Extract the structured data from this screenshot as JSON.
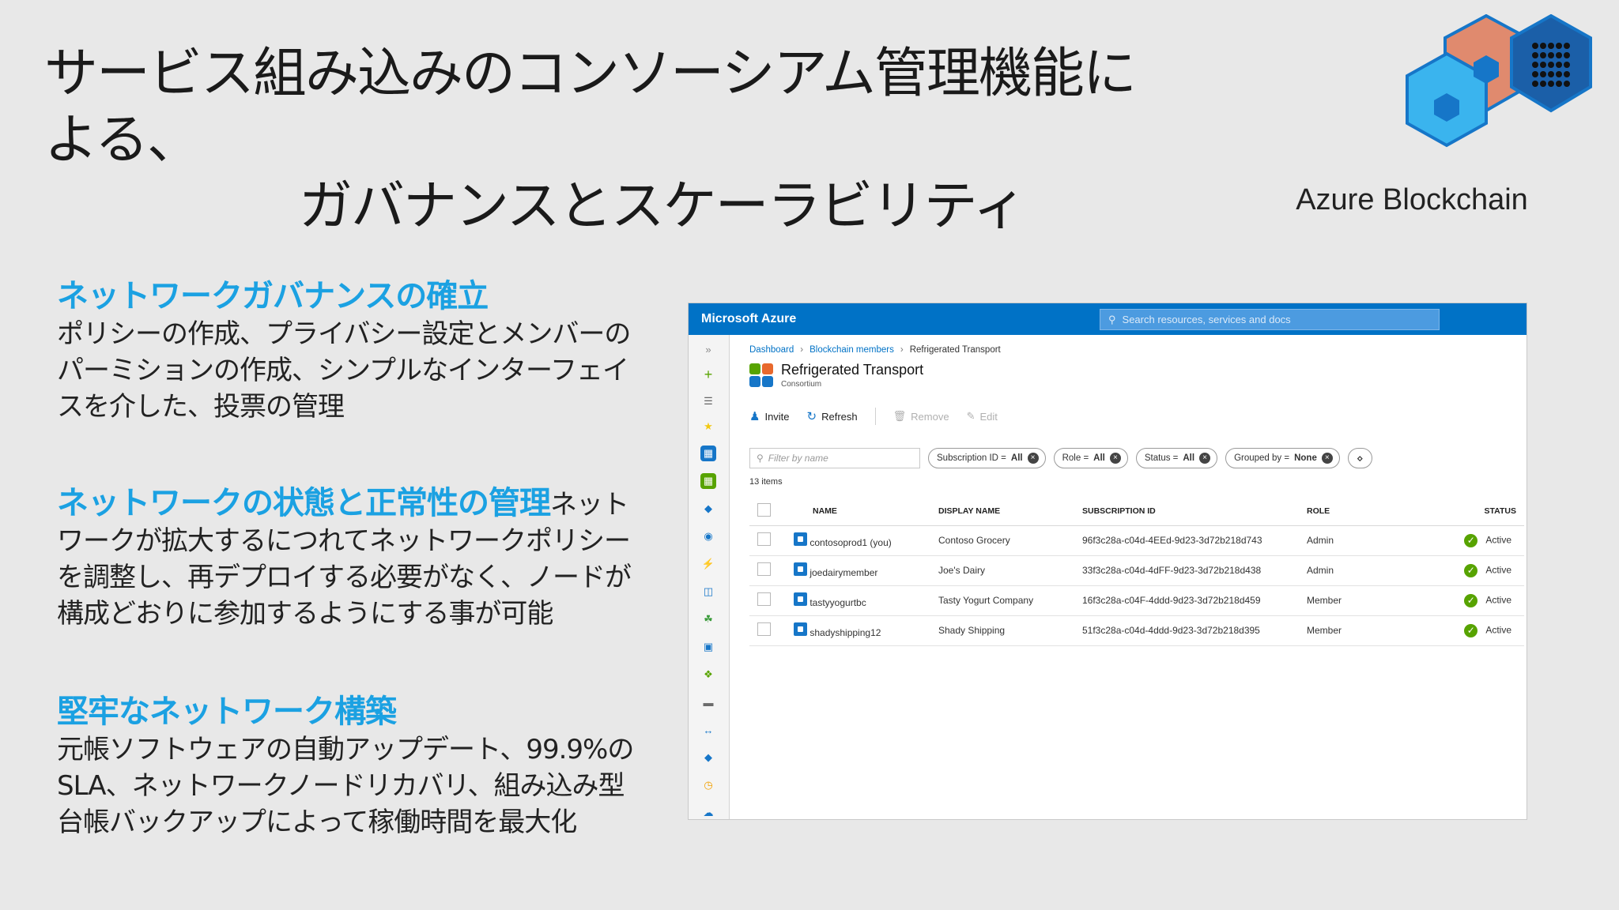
{
  "slide": {
    "title_line1": "サービス組み込みのコンソーシアム管理機能による、",
    "title_line2": "ガバナンスとスケーラビリティ",
    "logo_caption": "Azure Blockchain"
  },
  "sections": [
    {
      "heading": "ネットワークガバナンスの確立",
      "body": "ポリシーの作成、プライバシー設定とメンバーのパーミションの作成、シンプルなインターフェイスを介した、投票の管理"
    },
    {
      "heading": "ネットワークの状態と正常性の管理",
      "body": "ネットワークが拡大するにつれてネットワークポリシーを調整し、再デプロイする必要がなく、ノードが構成どおりに参加するようにする事が可能"
    },
    {
      "heading": "堅牢なネットワーク構築",
      "body": "元帳ソフトウェアの自動アップデート、99.9%のSLA、ネットワークノードリカバリ、組み込み型台帳バックアップによって稼働時間を最大化"
    }
  ],
  "portal": {
    "brand": "Microsoft Azure",
    "search_placeholder": "Search resources, services and docs",
    "breadcrumb": [
      "Dashboard",
      "Blockchain members",
      "Refrigerated Transport"
    ],
    "resource_name": "Refrigerated Transport",
    "resource_type": "Consortium",
    "commands": {
      "invite": "Invite",
      "refresh": "Refresh",
      "remove": "Remove",
      "edit": "Edit"
    },
    "filter_placeholder": "Filter by name",
    "pills": [
      {
        "label": "Subscription ID = ",
        "value": "All"
      },
      {
        "label": "Role = ",
        "value": "All"
      },
      {
        "label": "Status = ",
        "value": "All"
      },
      {
        "label": "Grouped by = ",
        "value": "None"
      }
    ],
    "count": "13 items",
    "columns": [
      "NAME",
      "DISPLAY NAME",
      "SUBSCRIPTION ID",
      "ROLE",
      "STATUS"
    ],
    "rows": [
      {
        "name": "contosoprod1 (you)",
        "display": "Contoso Grocery",
        "sub": "96f3c28a-c04d-4EEd-9d23-3d72b218d743",
        "role": "Admin",
        "status": "Active"
      },
      {
        "name": "joedairymember",
        "display": "Joe's Dairy",
        "sub": "33f3c28a-c04d-4dFF-9d23-3d72b218d438",
        "role": "Admin",
        "status": "Active"
      },
      {
        "name": "tastyyogurtbc",
        "display": "Tasty Yogurt Company",
        "sub": "16f3c28a-c04F-4ddd-9d23-3d72b218d459",
        "role": "Member",
        "status": "Active"
      },
      {
        "name": "shadyshipping12",
        "display": "Shady Shipping",
        "sub": "51f3c28a-c04d-4ddd-9d23-3d72b218d395",
        "role": "Member",
        "status": "Active"
      }
    ]
  }
}
